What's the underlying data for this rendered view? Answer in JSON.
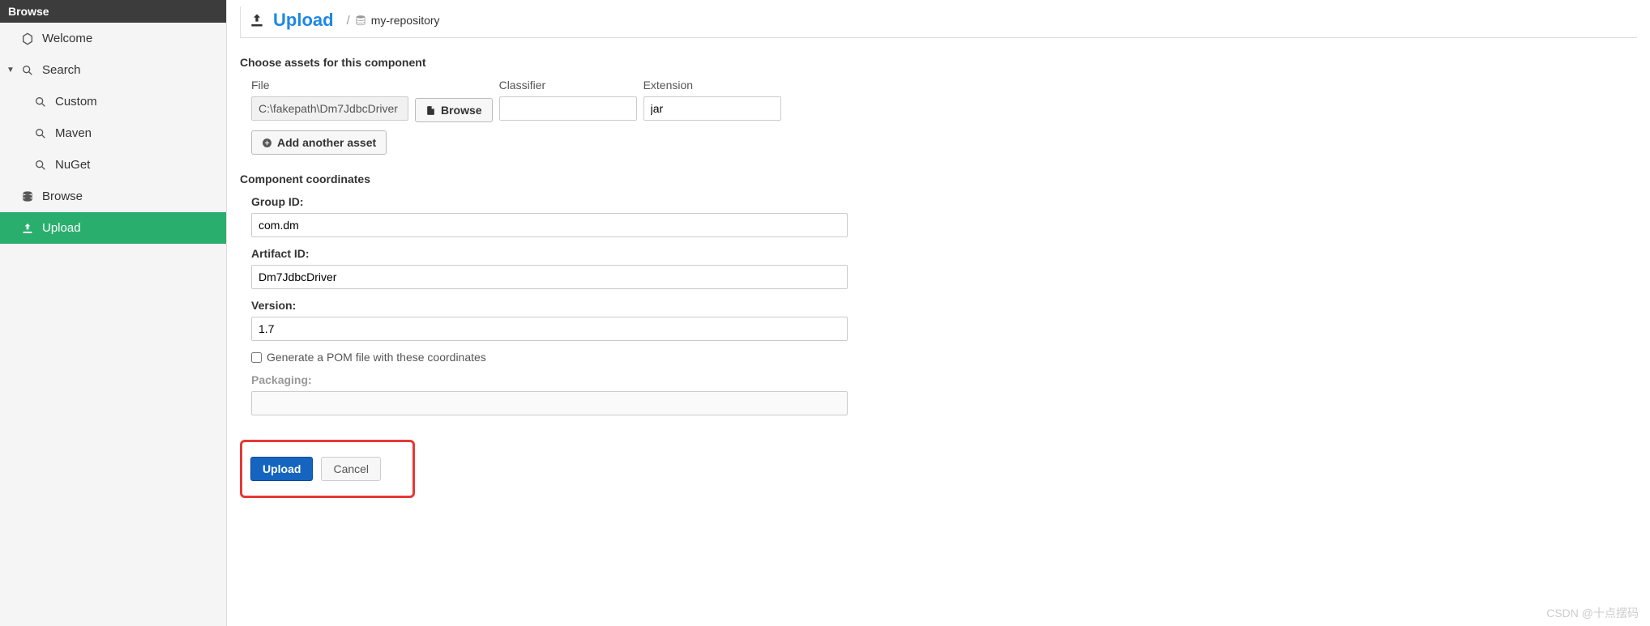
{
  "sidebar": {
    "header": "Browse",
    "items": [
      {
        "label": "Welcome",
        "icon": "hexagon",
        "sub": false,
        "caret": false,
        "active": false
      },
      {
        "label": "Search",
        "icon": "search",
        "sub": false,
        "caret": true,
        "active": false
      },
      {
        "label": "Custom",
        "icon": "search",
        "sub": true,
        "caret": false,
        "active": false
      },
      {
        "label": "Maven",
        "icon": "search",
        "sub": true,
        "caret": false,
        "active": false
      },
      {
        "label": "NuGet",
        "icon": "search",
        "sub": true,
        "caret": false,
        "active": false
      },
      {
        "label": "Browse",
        "icon": "database",
        "sub": false,
        "caret": false,
        "active": false
      },
      {
        "label": "Upload",
        "icon": "upload",
        "sub": false,
        "caret": false,
        "active": true
      }
    ]
  },
  "breadcrumb": {
    "title": "Upload",
    "repo": "my-repository"
  },
  "assets": {
    "section_title": "Choose assets for this component",
    "file_label": "File",
    "file_value": "C:\\fakepath\\Dm7JdbcDriver",
    "browse_label": "Browse",
    "classifier_label": "Classifier",
    "classifier_value": "",
    "extension_label": "Extension",
    "extension_value": "jar",
    "add_label": "Add another asset"
  },
  "coords": {
    "section_title": "Component coordinates",
    "group_label": "Group ID:",
    "group_value": "com.dm",
    "artifact_label": "Artifact ID:",
    "artifact_value": "Dm7JdbcDriver",
    "version_label": "Version:",
    "version_value": "1.7",
    "pom_label": "Generate a POM file with these coordinates",
    "packaging_label": "Packaging:",
    "packaging_value": ""
  },
  "actions": {
    "upload": "Upload",
    "cancel": "Cancel"
  },
  "watermark": "CSDN @十点摆码"
}
